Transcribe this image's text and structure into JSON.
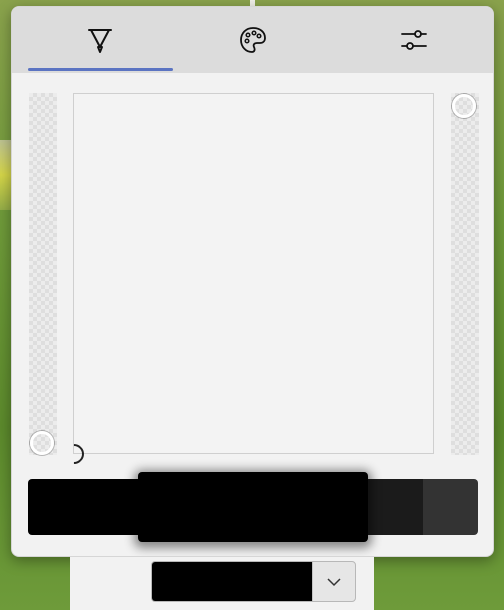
{
  "tabs": [
    {
      "id": "pen",
      "icon": "pen-icon",
      "active": true
    },
    {
      "id": "palette",
      "icon": "palette-icon",
      "active": false
    },
    {
      "id": "settings",
      "icon": "sliders-icon",
      "active": false
    }
  ],
  "colors": {
    "accent": "#5b74c2",
    "selected": "#000000",
    "swatches": [
      "#000000",
      "#000000",
      "#000000",
      "#1b1b1b",
      "#333333"
    ]
  },
  "combo": {
    "value_color": "#000000",
    "dropdown_icon": "chevron-down-icon"
  }
}
